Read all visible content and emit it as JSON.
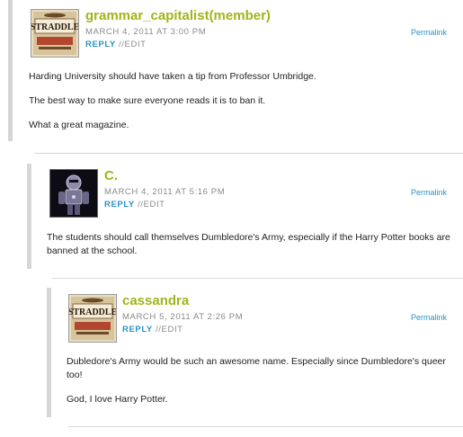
{
  "comments": [
    {
      "author": "grammar_capitalist(member)",
      "date": "MARCH 4, 2011 AT 3:00 PM",
      "reply_label": "REPLY",
      "sep": "//",
      "edit_label": "EDIT",
      "permalink": "Permalink",
      "avatar_icon": "straddle-magazine-logo",
      "avatar_text": "STRADDLE",
      "paragraphs": [
        "Harding University should have taken a tip from Professor Umbridge.",
        "The best way to make sure everyone reads it is to ban it.",
        "What a great magazine."
      ]
    },
    {
      "author": "C.",
      "date": "MARCH 4, 2011 AT 5:16 PM",
      "reply_label": "REPLY",
      "sep": "//",
      "edit_label": "EDIT",
      "permalink": "Permalink",
      "avatar_icon": "robot-figure-avatar",
      "paragraphs": [
        "The students should call themselves Dumbledore's Army, especially if the Harry Potter books are banned at the school."
      ]
    },
    {
      "author": "cassandra",
      "date": "MARCH 5, 2011 AT 2:26 PM",
      "reply_label": "REPLY",
      "sep": "//",
      "edit_label": "EDIT",
      "permalink": "Permalink",
      "avatar_icon": "straddle-magazine-logo",
      "avatar_text": "STRADDLE",
      "paragraphs": [
        "Dubledore's Army would be such an awesome name. Especially since Dumbledore's queer too!",
        "God, I love Harry Potter."
      ]
    }
  ],
  "colors": {
    "author": "#a3b319",
    "link": "#2b94c4",
    "meta": "#8a8a8a",
    "bar": "#d6d6d6"
  }
}
